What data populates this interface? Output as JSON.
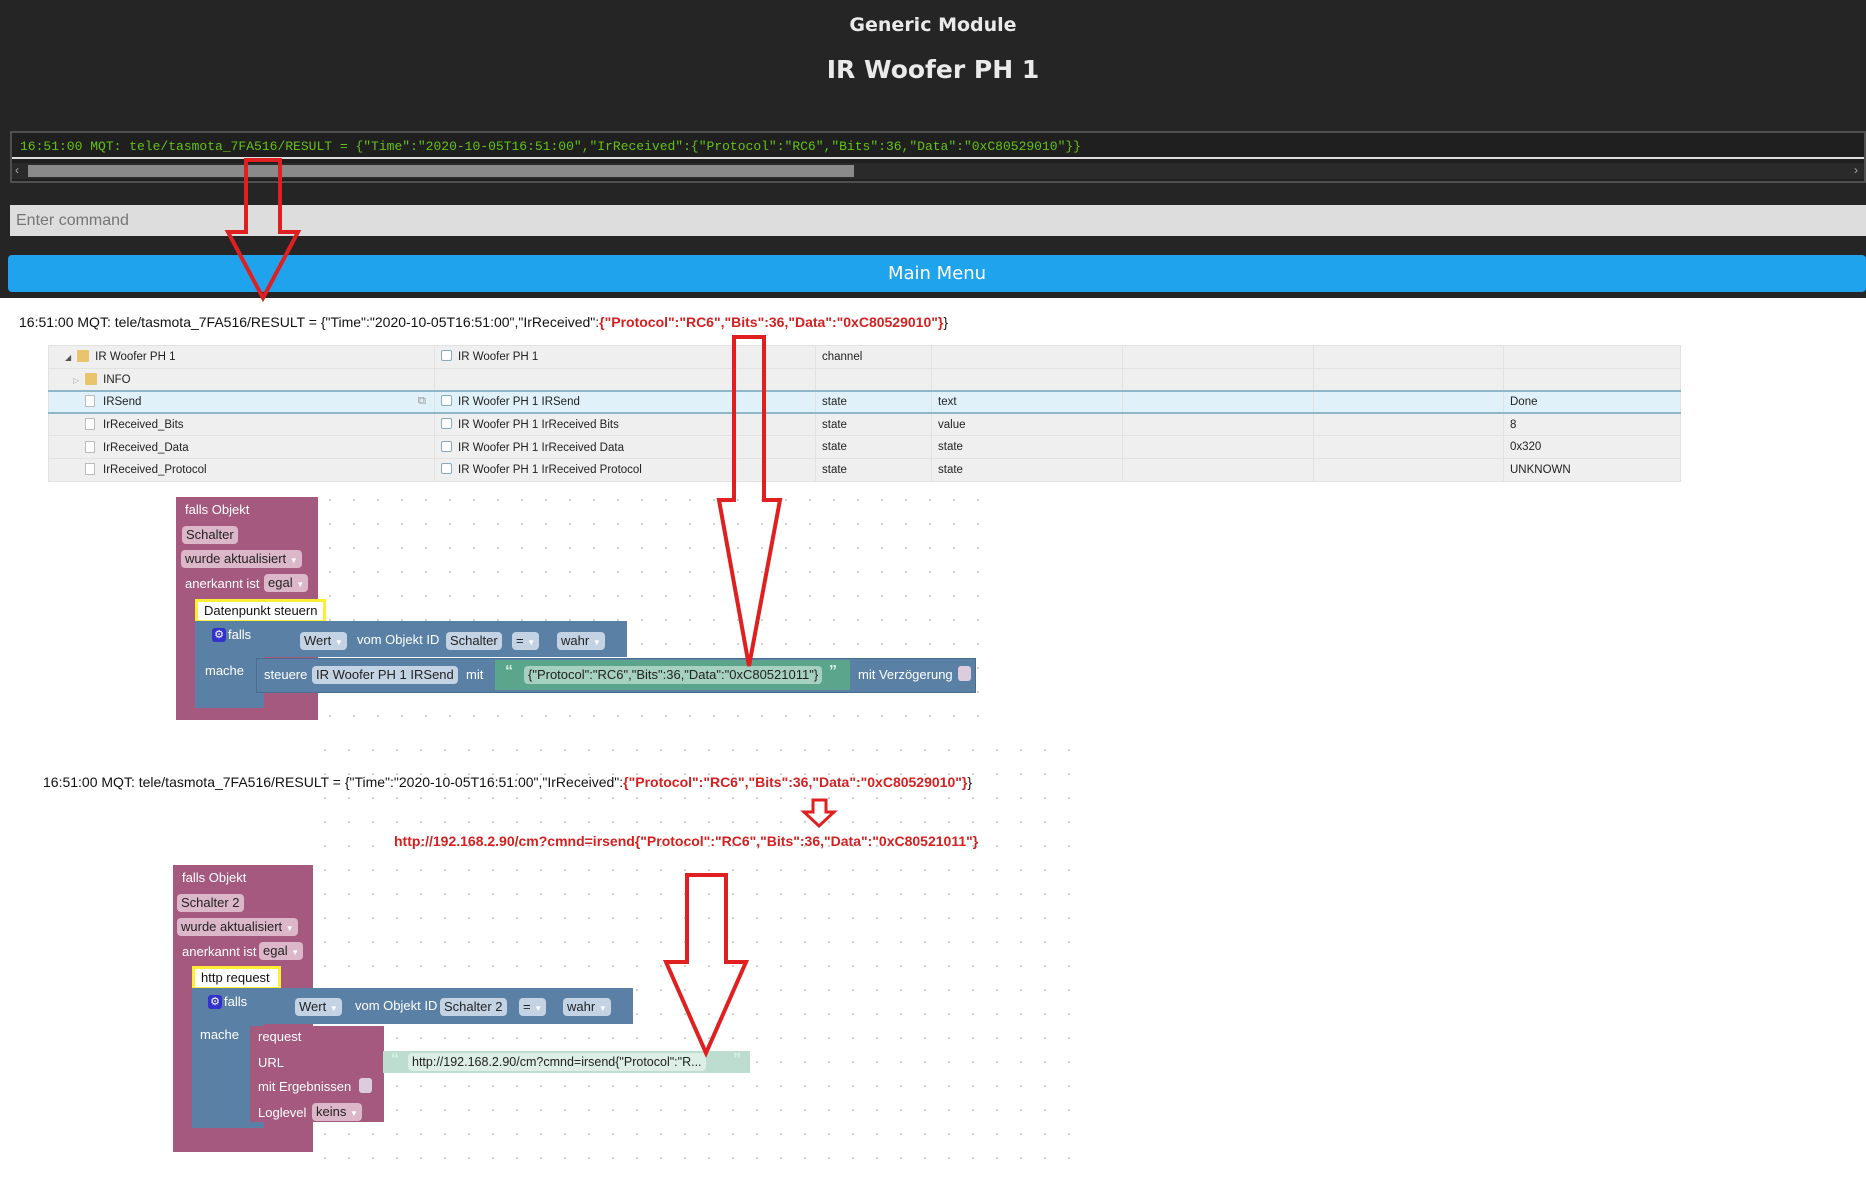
{
  "header": {
    "module": "Generic Module",
    "device": "IR Woofer PH 1"
  },
  "console": {
    "line": "16:51:00 MQT: tele/tasmota_7FA516/RESULT = {\"Time\":\"2020-10-05T16:51:00\",\"IrReceived\":{\"Protocol\":\"RC6\",\"Bits\":36,\"Data\":\"0xC80529010\"}}"
  },
  "command": {
    "placeholder": "Enter command"
  },
  "main_menu": "Main Menu",
  "annotation1": {
    "prefix": "16:51:00 MQT: tele/tasmota_7FA516/RESULT = {\"Time\":\"2020-10-05T16:51:00\",\"IrReceived\":",
    "highlight": "{\"Protocol\":\"RC6\",\"Bits\":36,\"Data\":\"0xC80529010\"}",
    "suffix": "}"
  },
  "objects": [
    {
      "id": "IR Woofer PH 1",
      "name": "IR Woofer PH 1",
      "type": "channel",
      "role": "",
      "value": ""
    },
    {
      "id": "INFO",
      "name": "",
      "type": "",
      "role": "",
      "value": ""
    },
    {
      "id": "IRSend",
      "name": "IR Woofer PH 1 IRSend",
      "type": "state",
      "role": "text",
      "value": "Done"
    },
    {
      "id": "IrReceived_Bits",
      "name": "IR Woofer PH 1 IrReceived Bits",
      "type": "state",
      "role": "value",
      "value": "8"
    },
    {
      "id": "IrReceived_Data",
      "name": "IR Woofer PH 1 IrReceived Data",
      "type": "state",
      "role": "state",
      "value": "0x320"
    },
    {
      "id": "IrReceived_Protocol",
      "name": "IR Woofer PH 1 IrReceived Protocol",
      "type": "state",
      "role": "state",
      "value": "UNKNOWN"
    }
  ],
  "block1": {
    "trigger": "falls Objekt",
    "object": "Schalter",
    "event": "wurde aktualisiert",
    "ack_label": "anerkannt ist",
    "ack": "egal",
    "comment": "Datenpunkt steuern",
    "if": "falls",
    "value": "Wert",
    "from_object": "vom Objekt ID",
    "cond_object": "Schalter",
    "op": "=",
    "cond_value": "wahr",
    "do": "mache",
    "control": "steuere",
    "target": "IR Woofer PH 1  IRSend",
    "with": "mit",
    "payload": "{\"Protocol\":\"RC6\",\"Bits\":36,\"Data\":\"0xC80521011\"}",
    "delay": "mit Verzögerung"
  },
  "annotation2": {
    "prefix": "16:51:00 MQT: tele/tasmota_7FA516/RESULT = {\"Time\":\"2020-10-05T16:51:00\",\"IrReceived\":",
    "highlight": "{\"Protocol\":\"RC6\",\"Bits\":36,\"Data\":\"0xC80529010\"}",
    "suffix": "}",
    "url": "http://192.168.2.90/cm?cmnd=irsend{\"Protocol\":\"RC6\",\"Bits\":36,\"Data\":\"0xC80521011\"}"
  },
  "block2": {
    "trigger": "falls Objekt",
    "object": "Schalter 2",
    "event": "wurde aktualisiert",
    "ack_label": "anerkannt ist",
    "ack": "egal",
    "comment": "http request",
    "if": "falls",
    "value": "Wert",
    "from_object": "vom Objekt ID",
    "cond_object": "Schalter 2",
    "op": "=",
    "cond_value": "wahr",
    "do": "mache",
    "request": "request",
    "url_label": "URL",
    "url": "http://192.168.2.90/cm?cmnd=irsend{\"Protocol\":\"R...",
    "results": "mit Ergebnissen",
    "loglevel_label": "Loglevel",
    "loglevel": "keins"
  },
  "colors": {
    "header": "#252525",
    "console_text": "#65c115",
    "menu": "#1fa3ec",
    "annotation": "#d42020",
    "block_purple": "#a5597f",
    "block_blue": "#5b80a5",
    "block_green": "#5ba58c"
  }
}
